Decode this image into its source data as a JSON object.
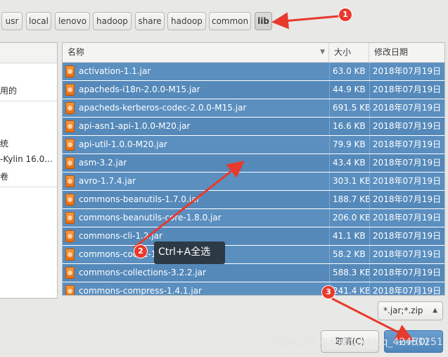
{
  "path_bar": {
    "crumbs": [
      "usr",
      "local",
      "lenovo",
      "hadoop",
      "share",
      "hadoop",
      "common",
      "lib"
    ]
  },
  "sidebar": {
    "items": [
      "用的",
      "统",
      "-Kylin 16.0...",
      "卷"
    ]
  },
  "file_list": {
    "headers": {
      "name": "名称",
      "size": "大小",
      "modified": "修改日期"
    },
    "rows": [
      {
        "name": "activation-1.1.jar",
        "size": "63.0 KB",
        "modified": "2018年07月19日"
      },
      {
        "name": "apacheds-i18n-2.0.0-M15.jar",
        "size": "44.9 KB",
        "modified": "2018年07月19日"
      },
      {
        "name": "apacheds-kerberos-codec-2.0.0-M15.jar",
        "size": "691.5 KB",
        "modified": "2018年07月19日"
      },
      {
        "name": "api-asn1-api-1.0.0-M20.jar",
        "size": "16.6 KB",
        "modified": "2018年07月19日"
      },
      {
        "name": "api-util-1.0.0-M20.jar",
        "size": "79.9 KB",
        "modified": "2018年07月19日"
      },
      {
        "name": "asm-3.2.jar",
        "size": "43.4 KB",
        "modified": "2018年07月19日"
      },
      {
        "name": "avro-1.7.4.jar",
        "size": "303.1 KB",
        "modified": "2018年07月19日"
      },
      {
        "name": "commons-beanutils-1.7.0.jar",
        "size": "188.7 KB",
        "modified": "2018年07月19日"
      },
      {
        "name": "commons-beanutils-core-1.8.0.jar",
        "size": "206.0 KB",
        "modified": "2018年07月19日"
      },
      {
        "name": "commons-cli-1.2.jar",
        "size": "41.1 KB",
        "modified": "2018年07月19日"
      },
      {
        "name": "commons-codec-1.4.jar",
        "size": "58.2 KB",
        "modified": "2018年07月19日"
      },
      {
        "name": "commons-collections-3.2.2.jar",
        "size": "588.3 KB",
        "modified": "2018年07月19日"
      },
      {
        "name": "commons-compress-1.4.1.jar",
        "size": "241.4 KB",
        "modified": "2018年07月19日"
      }
    ]
  },
  "filter": {
    "value": "*.jar;*.zip"
  },
  "buttons": {
    "cancel": "取消(C)",
    "open": "打开(O)"
  },
  "annotations": {
    "badge1": "1",
    "badge2": "2",
    "badge3": "3",
    "tooltip": "Ctrl+A全选",
    "watermark": "https://blog.csdn.net/qq_42451251"
  },
  "colors": {
    "selection": "#5a8fc0",
    "annotation": "#e8392d",
    "tooltip_bg": "#2c3a45"
  },
  "icons": [
    "jar-file-icon",
    "sort-down-icon",
    "dropdown-arrow-icon"
  ]
}
